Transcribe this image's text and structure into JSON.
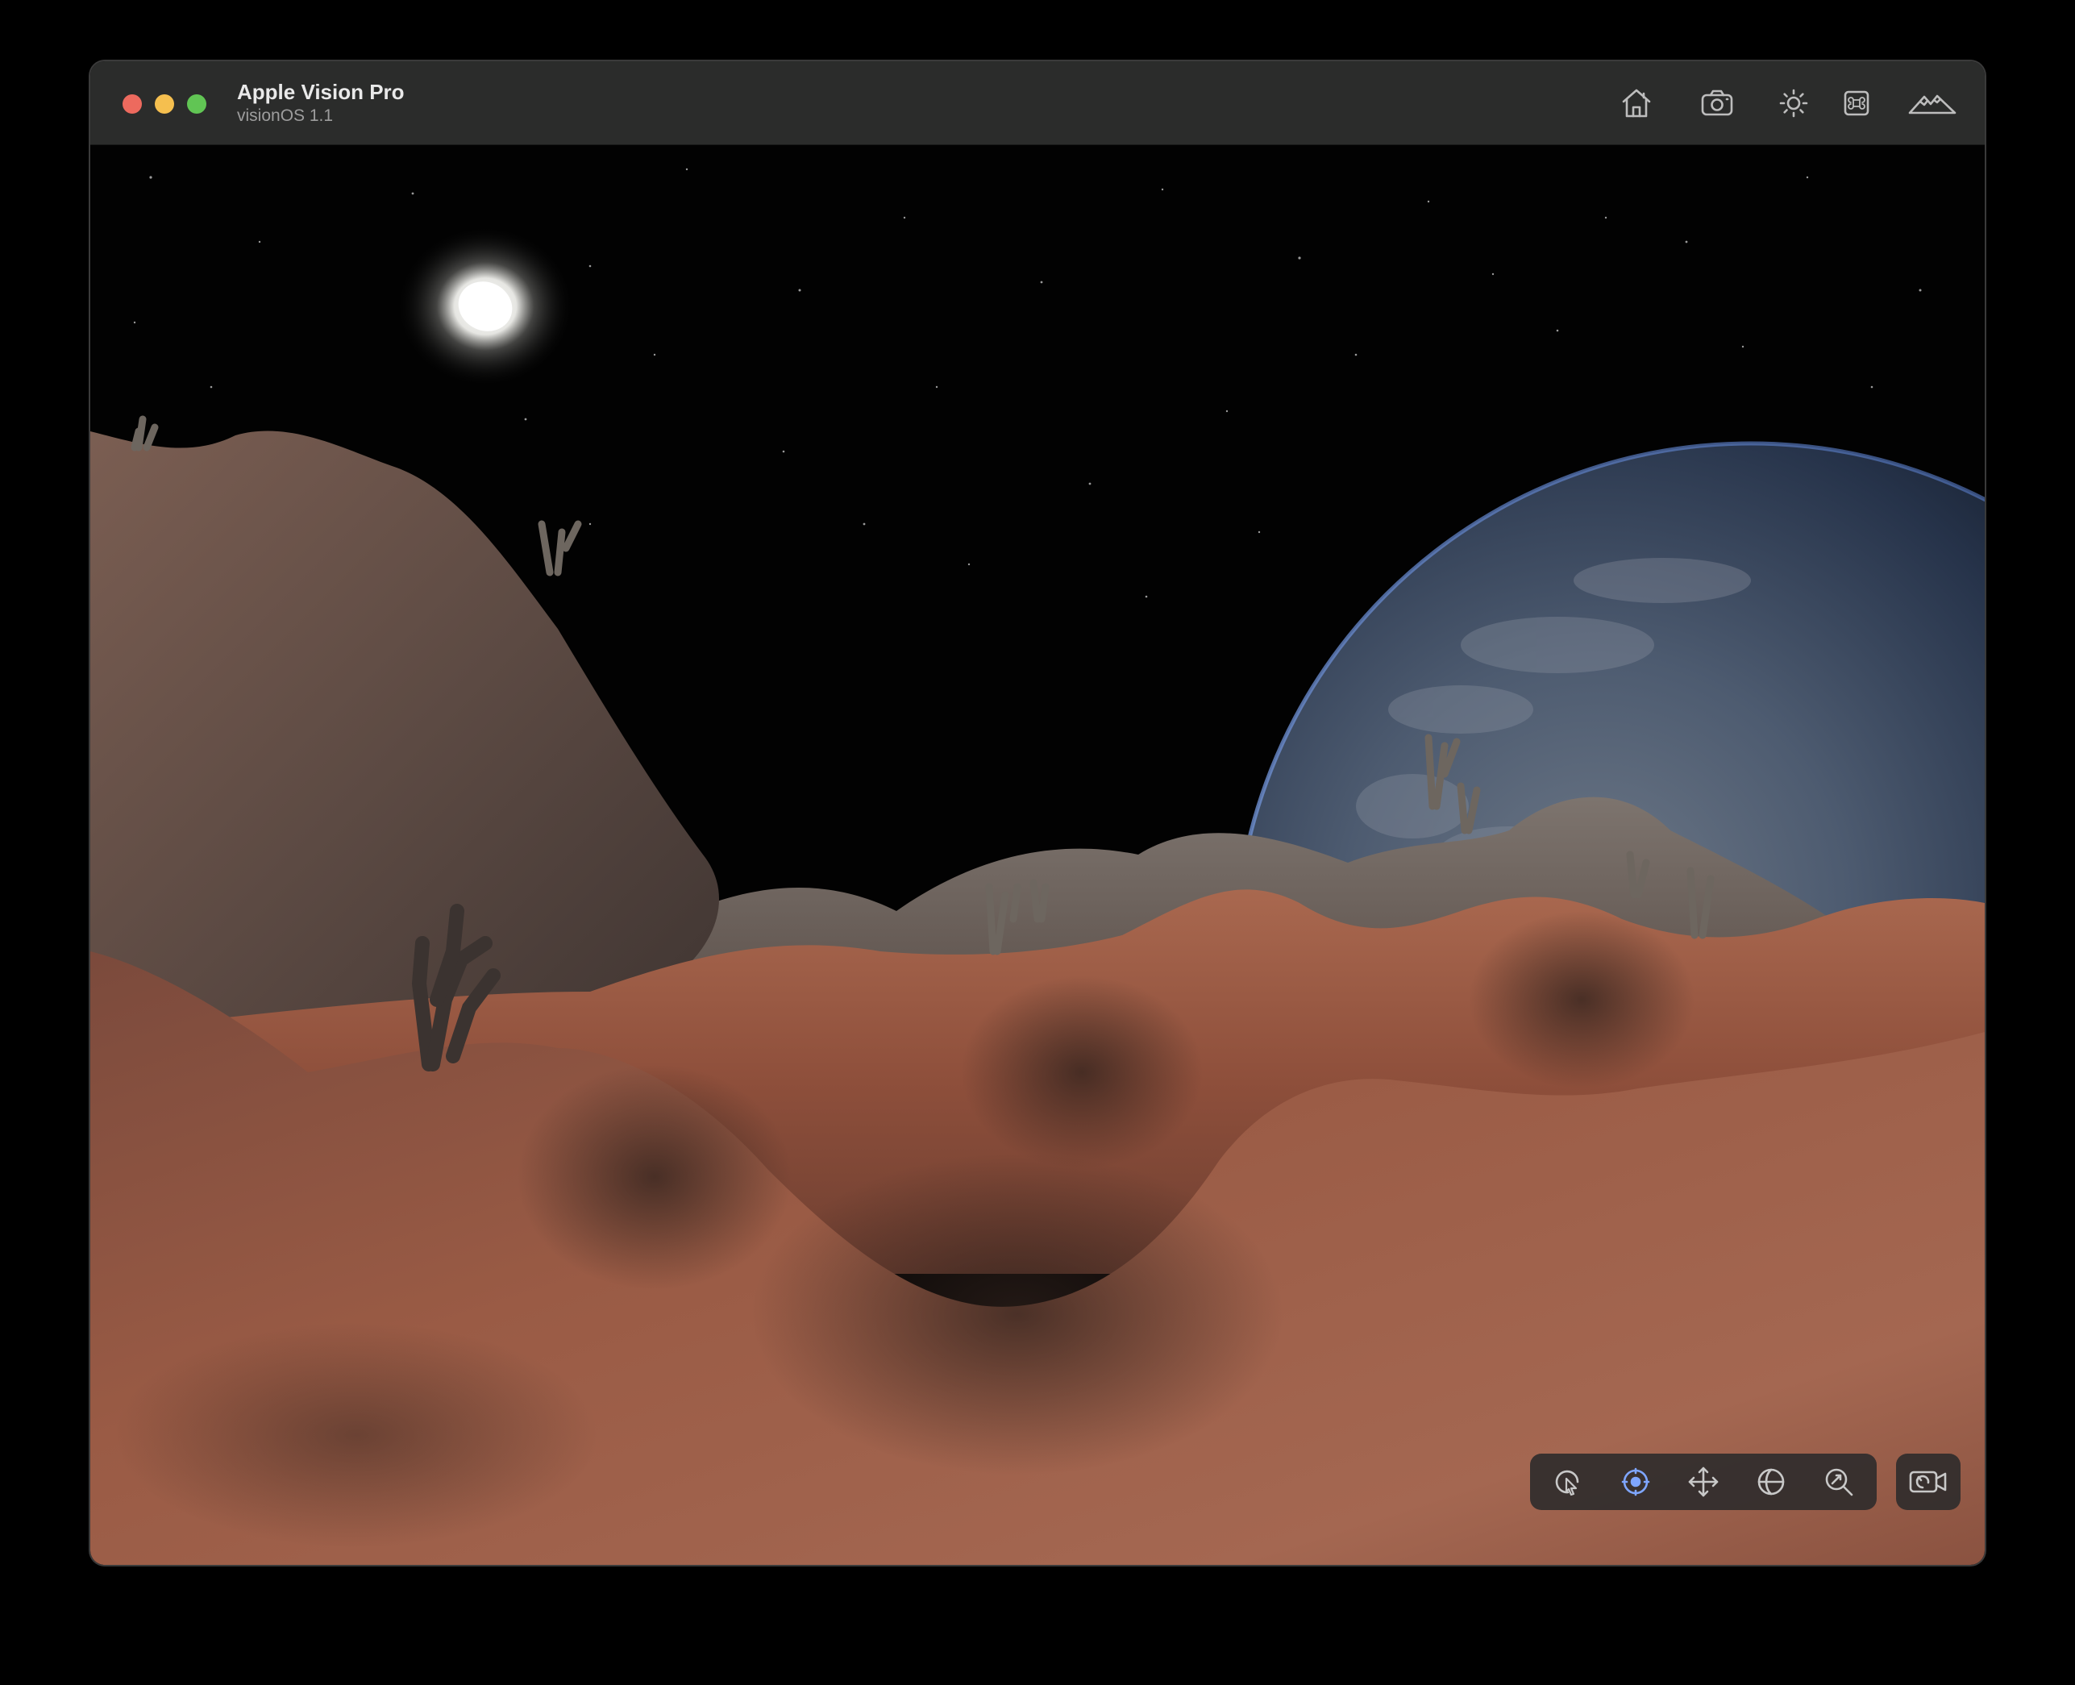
{
  "window": {
    "title": "Apple Vision Pro",
    "subtitle": "visionOS 1.1"
  },
  "toolbar": {
    "buttons": [
      {
        "name": "home",
        "icon": "house-icon"
      },
      {
        "name": "screenshot",
        "icon": "camera-icon"
      },
      {
        "name": "lighting",
        "icon": "sun-icon"
      },
      {
        "name": "keyboard-shortcuts",
        "icon": "command-icon"
      },
      {
        "name": "environment",
        "icon": "mountains-icon"
      }
    ]
  },
  "viewport": {
    "scene": "Lunar landscape with Earth rising and sun in starry sky"
  },
  "navigation_controls": {
    "modes": [
      {
        "name": "interact",
        "icon": "pointer-rotate-icon",
        "active": false
      },
      {
        "name": "look",
        "icon": "target-icon",
        "active": true
      },
      {
        "name": "pan",
        "icon": "move-arrows-icon",
        "active": false
      },
      {
        "name": "orbit",
        "icon": "orbit-icon",
        "active": false
      },
      {
        "name": "zoom",
        "icon": "magnifier-icon",
        "active": false
      }
    ],
    "reset_camera": {
      "icon": "camera-reset-icon"
    }
  },
  "colors": {
    "titlebar": "#2b2c2b",
    "active_control": "#7fa6ff",
    "close": "#ed6a5e",
    "minimize": "#f5bf4f",
    "maximize": "#61c554"
  }
}
